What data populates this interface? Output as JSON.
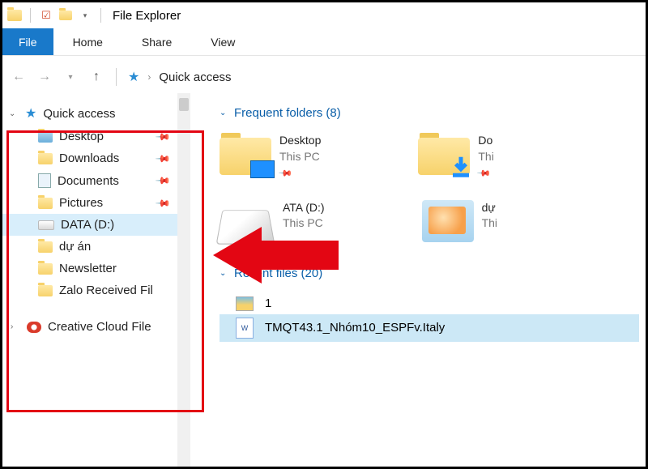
{
  "title": "File Explorer",
  "ribbon": {
    "file": "File",
    "home": "Home",
    "share": "Share",
    "view": "View"
  },
  "breadcrumb": {
    "location": "Quick access"
  },
  "sidebar": {
    "quick_access": "Quick access",
    "items": [
      {
        "label": "Desktop",
        "pinned": true,
        "icon": "folder"
      },
      {
        "label": "Downloads",
        "pinned": true,
        "icon": "folder"
      },
      {
        "label": "Documents",
        "pinned": true,
        "icon": "folder"
      },
      {
        "label": "Pictures",
        "pinned": true,
        "icon": "folder"
      },
      {
        "label": "DATA (D:)",
        "pinned": false,
        "icon": "drive",
        "selected": true
      },
      {
        "label": "dự án",
        "pinned": false,
        "icon": "folder"
      },
      {
        "label": "Newsletter",
        "pinned": false,
        "icon": "folder"
      },
      {
        "label": "Zalo Received Fil",
        "pinned": false,
        "icon": "folder"
      }
    ],
    "cc": "Creative Cloud File"
  },
  "main": {
    "frequent_label": "Frequent folders (8)",
    "recent_label": "Recent files (20)",
    "folders": [
      {
        "name": "Desktop",
        "sub": "This PC",
        "pinned": true,
        "type": "desktop"
      },
      {
        "name": "Do",
        "sub": "Thi",
        "pinned": true,
        "type": "downloads"
      },
      {
        "name": "ATA (D:)",
        "sub": "This PC",
        "pinned": false,
        "type": "drive"
      },
      {
        "name": "dự",
        "sub": "Thi",
        "pinned": false,
        "type": "pictures"
      }
    ],
    "recent": [
      {
        "name": "1",
        "type": "image"
      },
      {
        "name": "TMQT43.1_Nhóm10_ESPFv.Italy",
        "type": "word",
        "selected": true
      }
    ]
  }
}
